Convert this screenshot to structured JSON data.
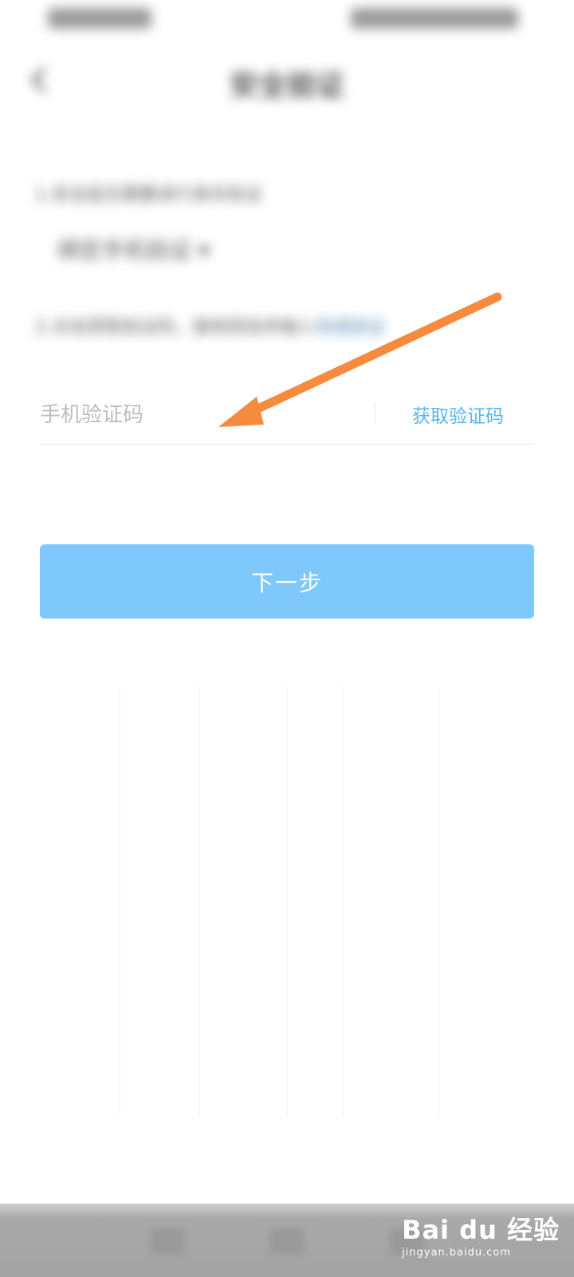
{
  "header": {
    "title": "安全验证"
  },
  "info": {
    "line1": "1.安全起见需要进行身份验证",
    "select_label": "绑定手机验证 ▾",
    "line2": "2.点击获取验证码，接收短信并输入",
    "line2_extra": "完成验证"
  },
  "form": {
    "code_placeholder": "手机验证码",
    "code_value": "",
    "get_code_label": "获取验证码",
    "next_label": "下一步"
  },
  "watermark": {
    "brand": "Bai du 经验",
    "url": "jingyan.baidu.com"
  },
  "colors": {
    "accent": "#53b6f3",
    "button": "#7ec8fb",
    "annotation_arrow": "#f68a3f"
  }
}
